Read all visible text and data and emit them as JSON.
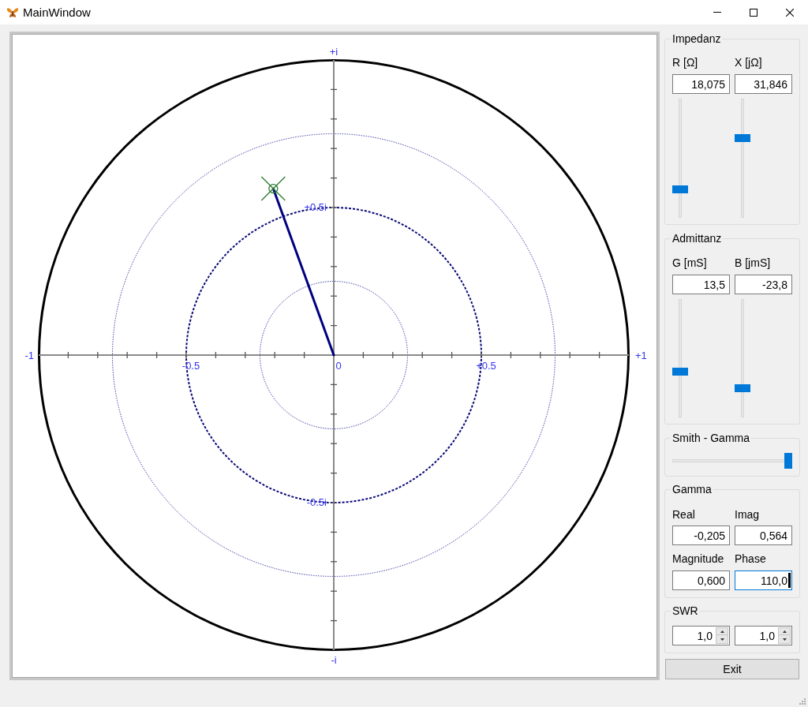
{
  "window": {
    "title": "MainWindow"
  },
  "chart": {
    "chart_data": {
      "type": "scatter",
      "x": [
        -0.205
      ],
      "series": [
        {
          "color": "#2e7d32",
          "values": [
            0.564
          ]
        }
      ],
      "xlim": [
        -1,
        1
      ],
      "ylim": [
        -1,
        1
      ],
      "xticks": [
        {
          "value": -0.5,
          "label": "-0.5"
        },
        {
          "value": 0,
          "label": "0"
        },
        {
          "value": 0.5,
          "label": "+0.5"
        }
      ],
      "yticks": [
        {
          "value": 0.5,
          "label": "+0.5i"
        },
        {
          "value": -0.5,
          "label": "-0.5i"
        }
      ],
      "annotations": [
        "-1",
        "+1",
        "+i",
        "-i"
      ]
    }
  },
  "impedance": {
    "title": "Impedanz",
    "fields": [
      {
        "label": "R [Ω]",
        "value": "18,075",
        "level": 0.22
      },
      {
        "label": "X [jΩ]",
        "value": "31,846",
        "level": 0.68
      }
    ]
  },
  "admittance": {
    "title": "Admittanz",
    "fields": [
      {
        "label": "G [mS]",
        "value": "13,5",
        "level": 0.38
      },
      {
        "label": "B [jmS]",
        "value": "-23,8",
        "level": 0.23
      }
    ]
  },
  "smith_gamma": {
    "title": "Smith - Gamma",
    "level": 1
  },
  "gamma": {
    "title": "Gamma",
    "fields": [
      {
        "label": "Real",
        "value": "-0,205",
        "focused": false
      },
      {
        "label": "Imag",
        "value": "0,564",
        "focused": false
      },
      {
        "label": "Magnitude",
        "value": "0,600",
        "focused": false
      },
      {
        "label": "Phase",
        "value": "110,0",
        "focused": true
      }
    ]
  },
  "swr": {
    "title": "SWR",
    "spinners": [
      {
        "value": "1,0"
      },
      {
        "value": "1,0"
      }
    ]
  },
  "buttons": [
    {
      "label": "Exit"
    }
  ]
}
